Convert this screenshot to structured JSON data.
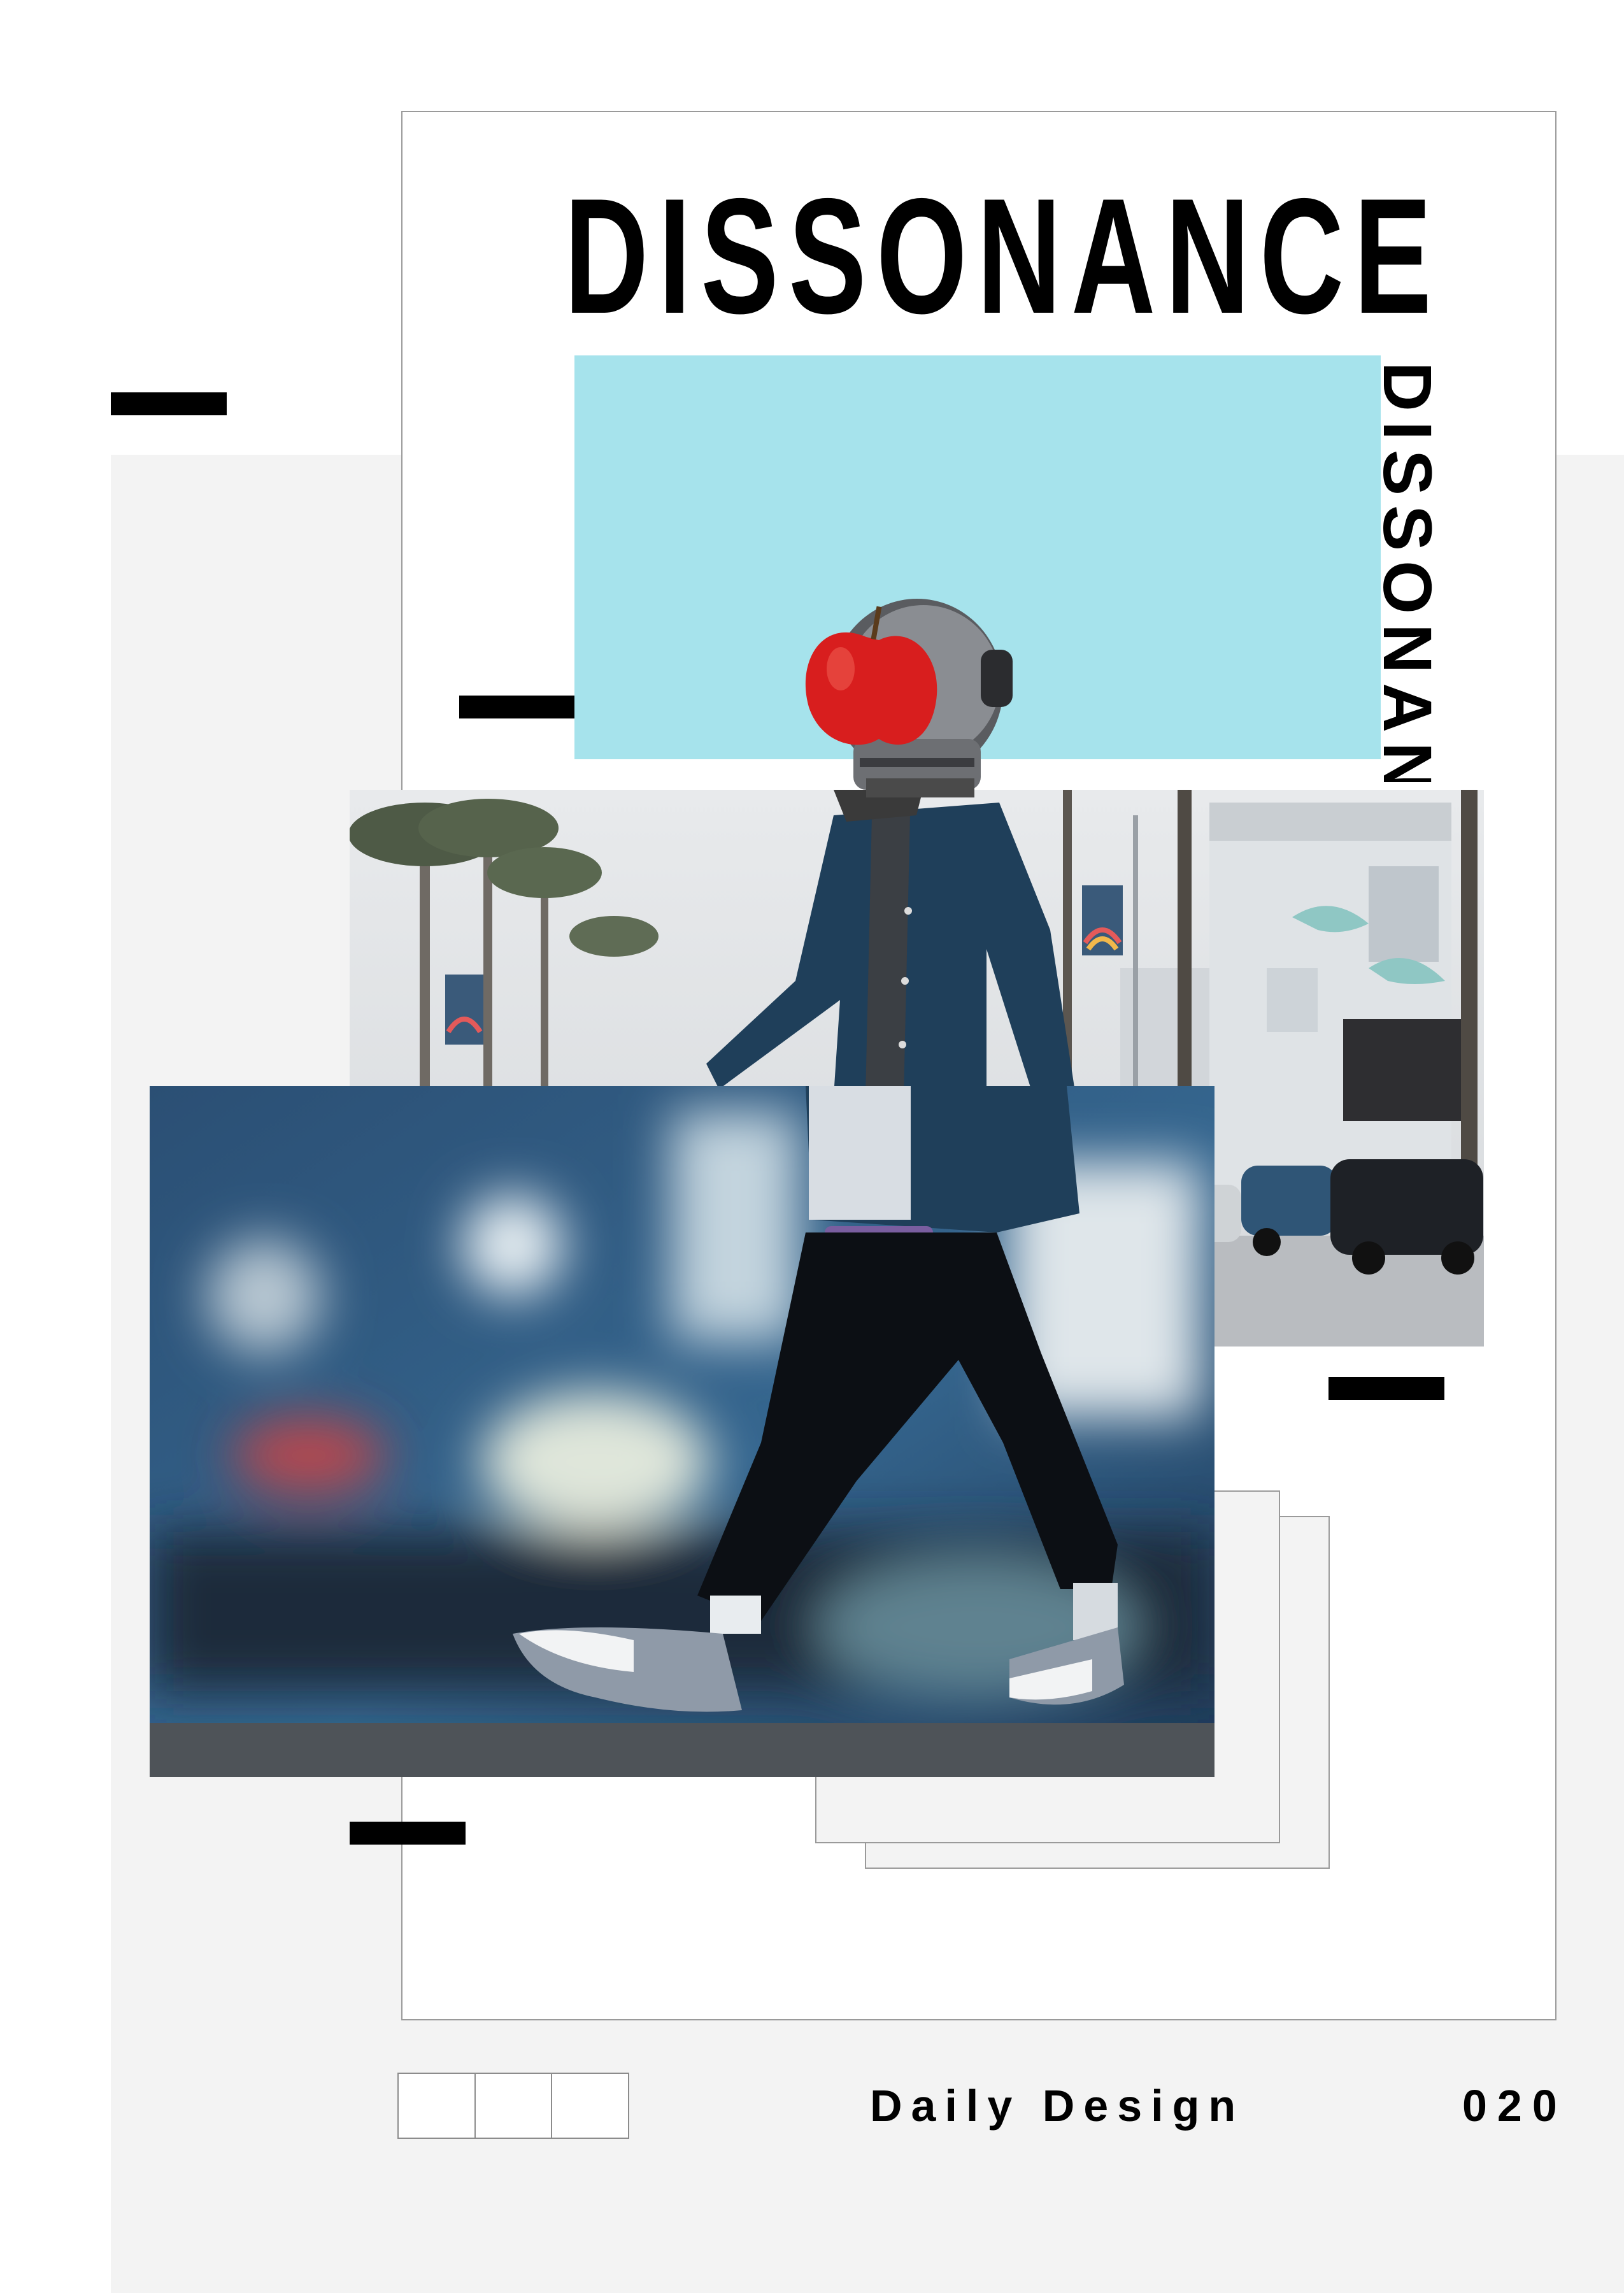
{
  "poster": {
    "title": "DISSONANCE",
    "vertical_title": "DISSONANC",
    "series_label": "Daily Design",
    "issue_number": "020"
  },
  "colors": {
    "background": "#ffffff",
    "panel_gray": "#f3f3f3",
    "accent_cyan": "#a6e3ec",
    "ink": "#000000",
    "apple_red": "#d81e1e",
    "jacket_navy": "#1f3f5a",
    "pants_black": "#0c0f14",
    "bokeh_blue": "#2f5f88"
  },
  "icons": {
    "apple": "apple-icon",
    "helmet": "astronaut-helmet-icon"
  }
}
